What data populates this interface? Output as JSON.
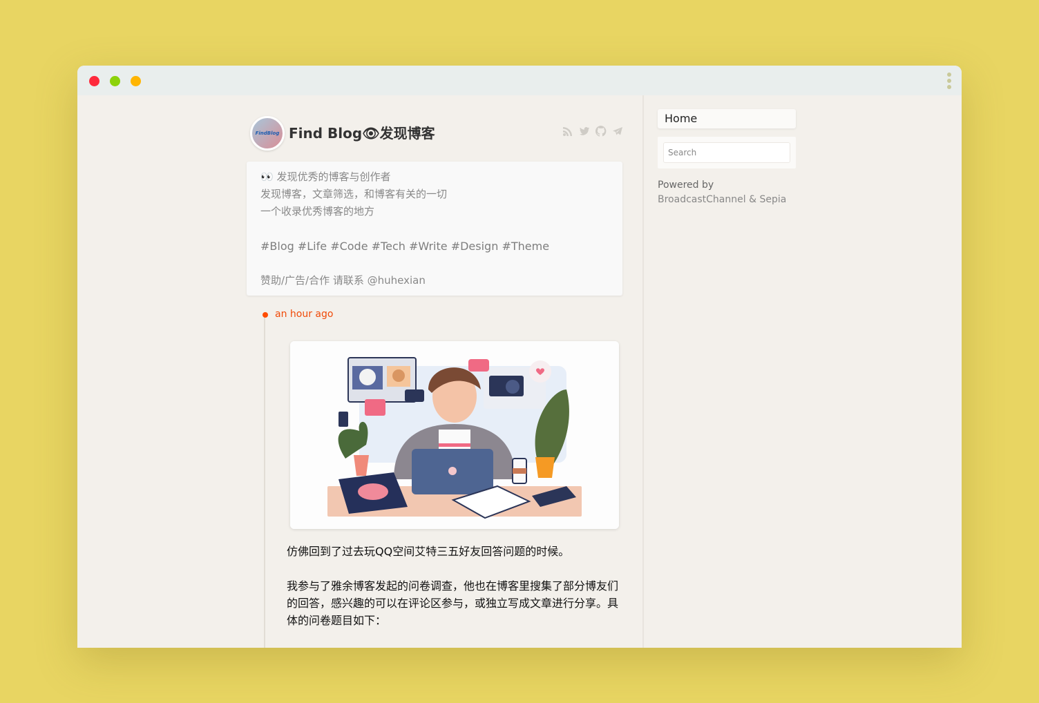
{
  "window": {
    "controls": [
      "close",
      "minimize",
      "maximize"
    ],
    "menu_icon": "vertical-dots-icon"
  },
  "header": {
    "avatar_text": "FindBlog",
    "title": "Find Blog👁发现博客",
    "social_icons": [
      "rss-icon",
      "twitter-icon",
      "github-icon",
      "telegram-icon"
    ]
  },
  "description": {
    "lines": [
      "👀 发现优秀的博客与创作者",
      "发现博客，文章筛选，和博客有关的一切",
      "一个收录优秀博客的地方"
    ],
    "tags": "#Blog #Life #Code #Tech #Write #Design #Theme",
    "contact": "赞助/广告/合作 请联系 @huhexian"
  },
  "post": {
    "time": "an hour ago",
    "image_alt": "Illustration of a person working on a laptop at a desk with plants, coffee and social icons",
    "paragraphs": [
      "仿佛回到了过去玩QQ空间艾特三五好友回答问题的时候。",
      "我参与了雅余博客发起的问卷调查，他也在博客里搜集了部分博友们的回答，感兴趣的可以在评论区参与，或独立写成文章进行分享。具体的问卷题目如下："
    ]
  },
  "sidebar": {
    "nav": [
      {
        "label": "Home"
      }
    ],
    "search_placeholder": "Search",
    "powered_by": "Powered by",
    "powered_brand": "BroadcastChannel & Sepia"
  },
  "colors": {
    "accent": "#f04a08",
    "background": "#e8d562",
    "page": "#f3f0eb"
  }
}
